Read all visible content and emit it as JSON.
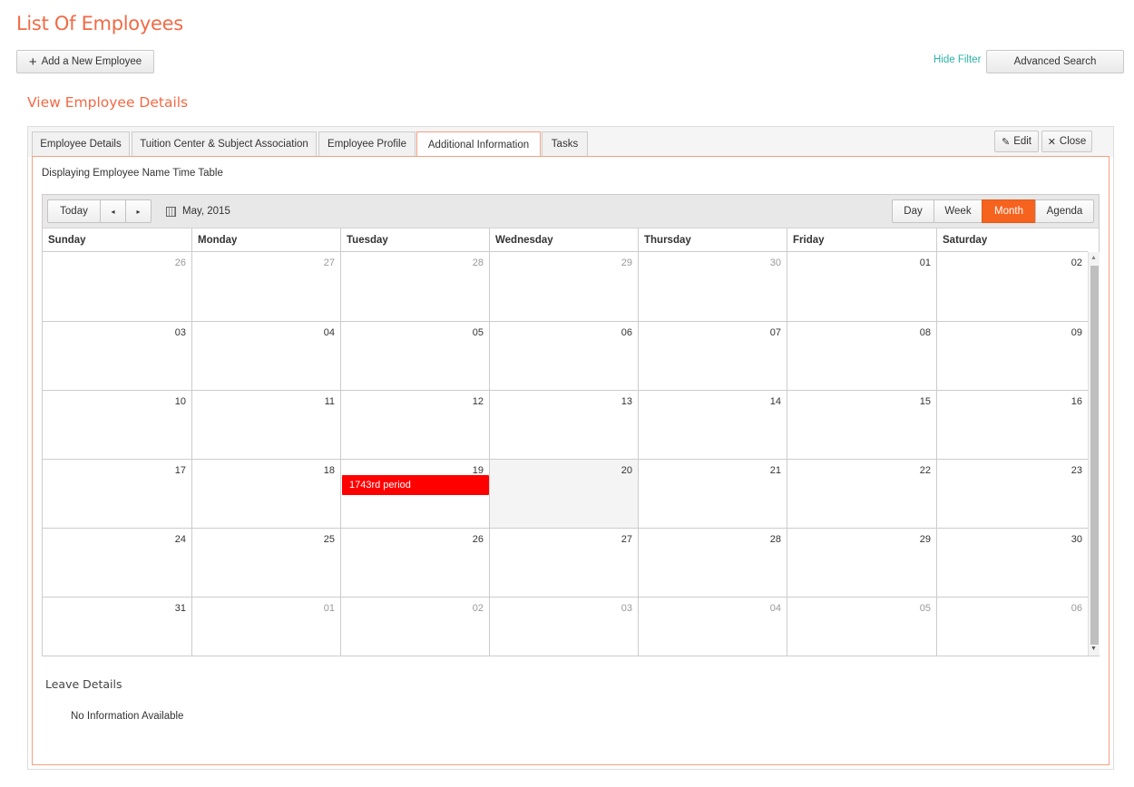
{
  "page": {
    "title": "List Of Employees",
    "add_button_label": "Add a New Employee",
    "add_icon": "plus-icon",
    "hide_filter_label": "Hide Filter",
    "advanced_search_label": "Advanced Search",
    "section_title": "View Employee Details"
  },
  "tabs": [
    {
      "label": "Employee Details",
      "active": false
    },
    {
      "label": "Tuition Center & Subject Association",
      "active": false
    },
    {
      "label": "Employee Profile",
      "active": false
    },
    {
      "label": "Additional Information",
      "active": true
    },
    {
      "label": "Tasks",
      "active": false
    }
  ],
  "actions": {
    "edit_label": "Edit",
    "edit_icon": "pencil-icon",
    "close_label": "Close",
    "close_icon": "close-icon"
  },
  "content": {
    "display_text": "Displaying Employee Name Time Table"
  },
  "calendar": {
    "today_label": "Today",
    "prev_icon": "◂",
    "next_icon": "▸",
    "month_label": "May, 2015",
    "views": [
      "Day",
      "Week",
      "Month",
      "Agenda"
    ],
    "active_view": "Month",
    "accent_color": "#f6631f",
    "day_headers": [
      "Sunday",
      "Monday",
      "Tuesday",
      "Wednesday",
      "Thursday",
      "Friday",
      "Saturday"
    ],
    "weeks": [
      [
        {
          "d": "26",
          "o": true
        },
        {
          "d": "27",
          "o": true
        },
        {
          "d": "28",
          "o": true
        },
        {
          "d": "29",
          "o": true
        },
        {
          "d": "30",
          "o": true
        },
        {
          "d": "01"
        },
        {
          "d": "02"
        }
      ],
      [
        {
          "d": "03"
        },
        {
          "d": "04"
        },
        {
          "d": "05"
        },
        {
          "d": "06"
        },
        {
          "d": "07"
        },
        {
          "d": "08"
        },
        {
          "d": "09"
        }
      ],
      [
        {
          "d": "10"
        },
        {
          "d": "11"
        },
        {
          "d": "12"
        },
        {
          "d": "13"
        },
        {
          "d": "14"
        },
        {
          "d": "15"
        },
        {
          "d": "16"
        }
      ],
      [
        {
          "d": "17"
        },
        {
          "d": "18"
        },
        {
          "d": "19",
          "event": "1743rd period"
        },
        {
          "d": "20",
          "today": true
        },
        {
          "d": "21"
        },
        {
          "d": "22"
        },
        {
          "d": "23"
        }
      ],
      [
        {
          "d": "24"
        },
        {
          "d": "25"
        },
        {
          "d": "26"
        },
        {
          "d": "27"
        },
        {
          "d": "28"
        },
        {
          "d": "29"
        },
        {
          "d": "30"
        }
      ],
      [
        {
          "d": "31"
        },
        {
          "d": "01",
          "o": true
        },
        {
          "d": "02",
          "o": true
        },
        {
          "d": "03",
          "o": true
        },
        {
          "d": "04",
          "o": true
        },
        {
          "d": "05",
          "o": true
        },
        {
          "d": "06",
          "o": true
        }
      ]
    ],
    "event_color": "#ff0000"
  },
  "leave": {
    "title": "Leave Details",
    "empty_text": "No Information Available"
  }
}
